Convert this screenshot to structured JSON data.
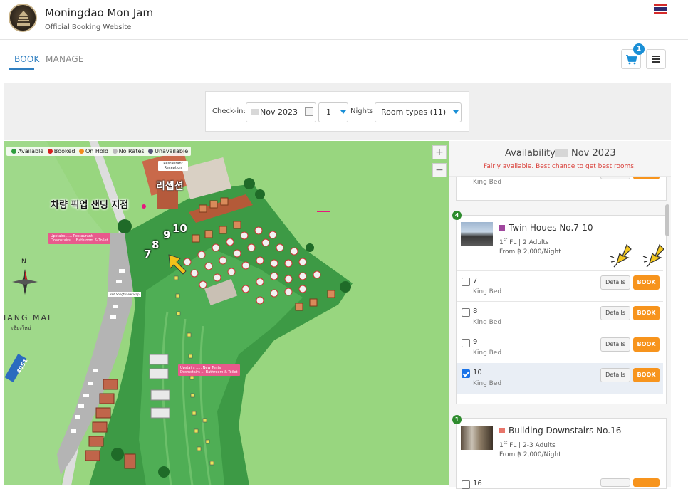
{
  "header": {
    "title": "Moningdao Mon Jam",
    "subtitle": "Official Booking Website"
  },
  "tabs": {
    "book": "BOOK",
    "manage": "MANAGE"
  },
  "cart": {
    "count": "1"
  },
  "search": {
    "checkin_label": "Check-in:",
    "checkin_value": "Nov 2023",
    "nights_value": "1",
    "nights_label": "Nights",
    "room_types_value": "Room types (11)"
  },
  "map": {
    "legend": [
      {
        "label": "Available",
        "color": "#2e9e3e"
      },
      {
        "label": "Booked",
        "color": "#d62020"
      },
      {
        "label": "On Hold",
        "color": "#f28c1c"
      },
      {
        "label": "No Rates",
        "color": "#bbbbbb"
      },
      {
        "label": "Unavailable",
        "color": "#555577"
      }
    ],
    "zoom_in": "+",
    "zoom_out": "−",
    "reception_kr": "리셉션",
    "reception_sign": "Restaurant Reception",
    "pickup_kr": "차량 픽업 샌딩 지점",
    "room_numbers": [
      "7",
      "8",
      "9",
      "10"
    ],
    "compass_north": "N",
    "city": "IANG MAI",
    "city_thai": "เชียงใหม่",
    "road_number": "4051",
    "tag_upper": "Upstairs ..... Restaurant\nDownstairs ... Bathroom & Toilet",
    "tag_lower": "Upstairs ..... New Tents\nDownstairs ... Bathroom & Toilet",
    "bus_stop": "Red Songthaew Stop"
  },
  "availability": {
    "title": "Availability",
    "date": "Nov 2023",
    "subtitle": "Fairly available. Best chance to get best rooms.",
    "top_bed": "King Bed",
    "groups": [
      {
        "count": "4",
        "name": "Twin Houes No.7-10",
        "swatch": "#a0479e",
        "floor_sup": "st",
        "floor_pre": "1",
        "floor_rest": " FL | 2 Adults",
        "price": "From ฿ 2,000/Night",
        "units": [
          {
            "num": "7",
            "bed": "King Bed",
            "checked": false
          },
          {
            "num": "8",
            "bed": "King Bed",
            "checked": false
          },
          {
            "num": "9",
            "bed": "King Bed",
            "checked": false
          },
          {
            "num": "10",
            "bed": "King Bed",
            "checked": true
          }
        ]
      },
      {
        "count": "1",
        "name": "Building Downstairs No.16",
        "swatch": "#e8766b",
        "floor_pre": "1",
        "floor_sup": "st",
        "floor_rest": " FL | 2-3 Adults",
        "price": "From ฿ 2,000/Night",
        "units": [
          {
            "num": "16",
            "bed": "",
            "checked": false
          }
        ]
      }
    ],
    "details_label": "Details",
    "book_label": "BOOK"
  }
}
